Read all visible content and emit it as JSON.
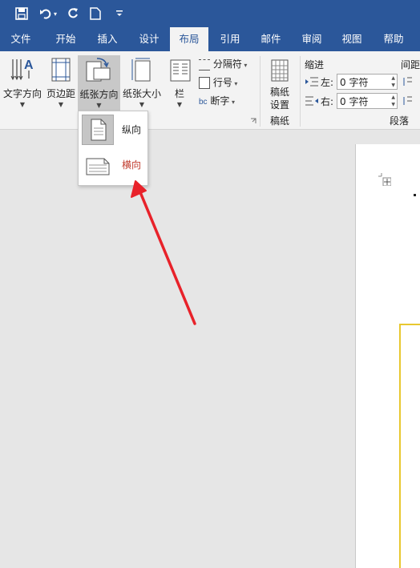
{
  "qat": {
    "icons": [
      "save-icon",
      "undo-icon",
      "redo-icon",
      "new-document-icon",
      "customize-icon"
    ]
  },
  "tabs": [
    "文件",
    "开始",
    "插入",
    "设计",
    "布局",
    "引用",
    "邮件",
    "审阅",
    "视图",
    "帮助"
  ],
  "active_tab": "布局",
  "ribbon": {
    "text_direction": "文字方向",
    "margins": "页边距",
    "orientation": "纸张方向",
    "size": "纸张大小",
    "columns": "栏",
    "breaks": "分隔符",
    "line_numbers": "行号",
    "hyphenation": "断字",
    "manuscript_button": [
      "稿纸",
      "设置"
    ],
    "manuscript_group": "稿纸",
    "indent_title": "缩进",
    "spacing_title": "间距",
    "indent_left_label": "左:",
    "indent_left_value": "0 字符",
    "indent_right_label": "右:",
    "indent_right_value": "0 字符",
    "paragraph_group": "段落"
  },
  "orientation_menu": {
    "portrait": "纵向",
    "landscape": "横向"
  },
  "colors": {
    "title_bar": "#2b579a",
    "arrow": "#e8222a",
    "text_frame": "#e8c830",
    "landscape_text": "#c0392b"
  }
}
